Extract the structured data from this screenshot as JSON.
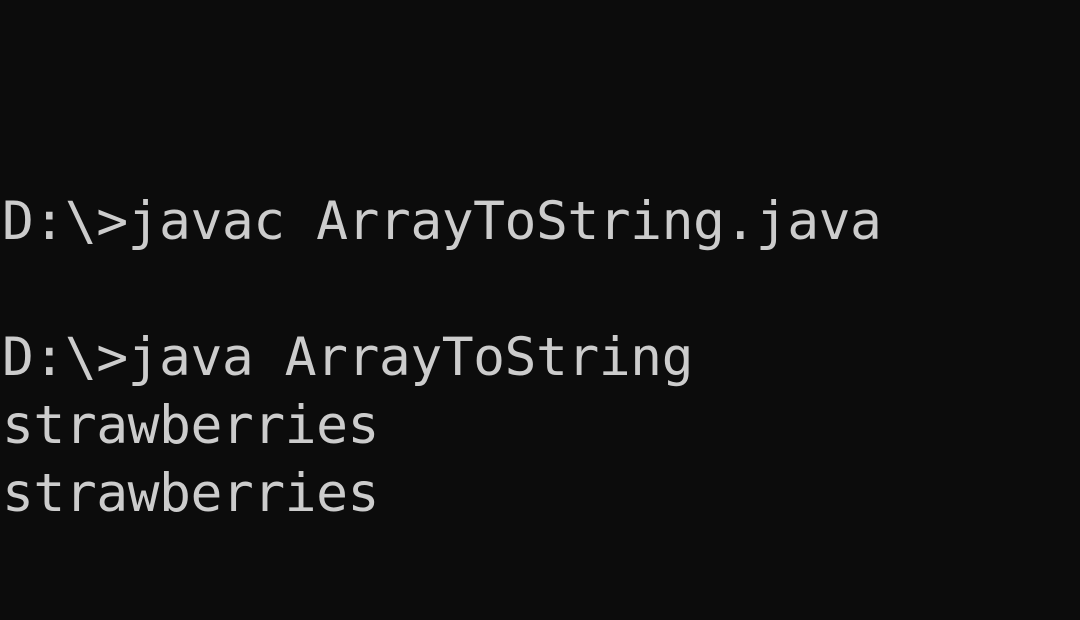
{
  "terminal": {
    "colors": {
      "background": "#0c0c0c",
      "text": "#cccccc"
    },
    "lines": [
      "D:\\>javac ArrayToString.java",
      "",
      "D:\\>java ArrayToString",
      "strawberries",
      "strawberries"
    ]
  }
}
